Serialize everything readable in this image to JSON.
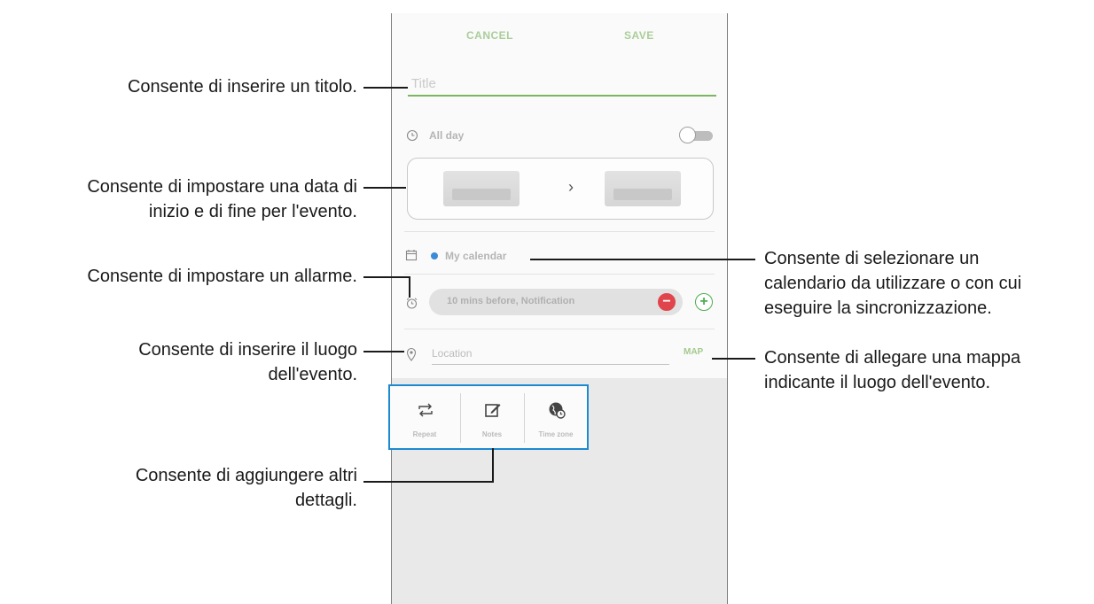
{
  "app": {
    "top_bar": {
      "cancel_label": "CANCEL",
      "save_label": "SAVE"
    },
    "title_field": {
      "placeholder": "Title"
    },
    "all_day": {
      "label": "All day",
      "icon": "clock-icon",
      "toggle_on": false
    },
    "date_range": {
      "arrow": "›"
    },
    "calendar": {
      "label": "My calendar",
      "icon": "calendar-icon",
      "dot_color": "#3b8bd6"
    },
    "reminder": {
      "label": "10 mins before, Notification",
      "icon": "alarm-clock-icon",
      "remove_symbol": "−",
      "add_symbol": "+"
    },
    "location": {
      "placeholder": "Location",
      "icon": "location-pin-icon",
      "map_label": "MAP"
    },
    "details": [
      {
        "label": "Repeat",
        "icon": "repeat-icon"
      },
      {
        "label": "Notes",
        "icon": "notes-icon"
      },
      {
        "label": "Time zone",
        "icon": "time-zone-icon"
      }
    ],
    "accent_color": "#6aa94a",
    "highlight_border_color": "#1d8ad0"
  },
  "annotations": {
    "title": "Consente di inserire un titolo.",
    "dates_line1": "Consente di impostare una data di",
    "dates_line2": "inizio e di fine per l'evento.",
    "alarm": "Consente di impostare un allarme.",
    "location_line1": "Consente di inserire il luogo",
    "location_line2": "dell'evento.",
    "details_line1": "Consente di aggiungere altri",
    "details_line2": "dettagli.",
    "calendar_line1": "Consente di selezionare un",
    "calendar_line2": "calendario da utilizzare o con cui",
    "calendar_line3": "eseguire la sincronizzazione.",
    "map_line1": "Consente di allegare una mappa",
    "map_line2": "indicante il luogo dell'evento."
  }
}
